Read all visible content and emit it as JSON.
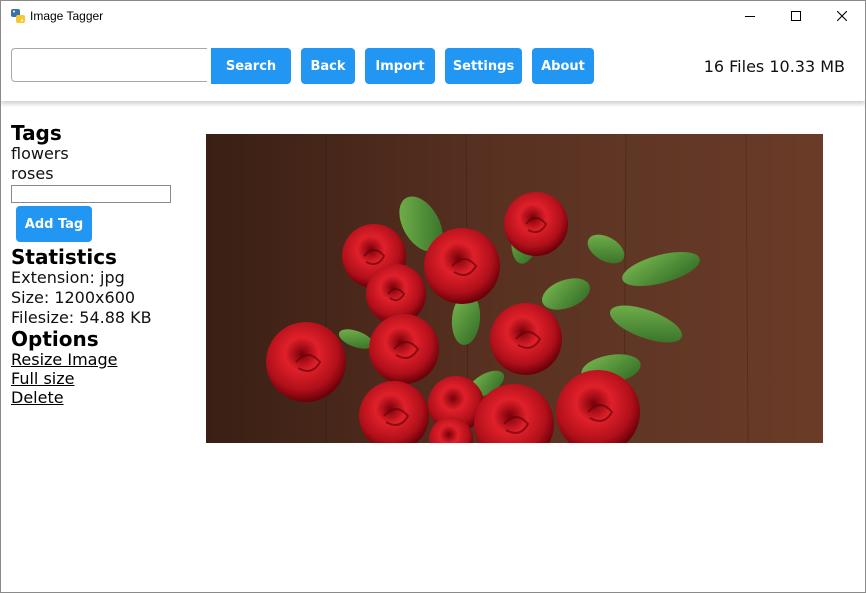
{
  "window": {
    "title": "Image Tagger",
    "icons": {
      "app": "python-icon",
      "minimize": "minimize-icon",
      "maximize": "maximize-icon",
      "close": "close-icon"
    }
  },
  "toolbar": {
    "search_value": "",
    "search_label": "Search",
    "back_label": "Back",
    "import_label": "Import",
    "settings_label": "Settings",
    "about_label": "About",
    "summary": "16 Files 10.33 MB"
  },
  "sidebar": {
    "tags_heading": "Tags",
    "tags": [
      "flowers",
      "roses"
    ],
    "tag_input_value": "",
    "add_tag_label": "Add Tag",
    "statistics_heading": "Statistics",
    "extension": "Extension: jpg",
    "size": "Size: 1200x600",
    "filesize": "Filesize: 54.88 KB",
    "options_heading": "Options",
    "options": [
      "Resize Image",
      "Full size",
      "Delete"
    ]
  },
  "colors": {
    "accent": "#2196f3",
    "rose_red": "#c8141c",
    "background_wood": "#4a2a1c"
  }
}
